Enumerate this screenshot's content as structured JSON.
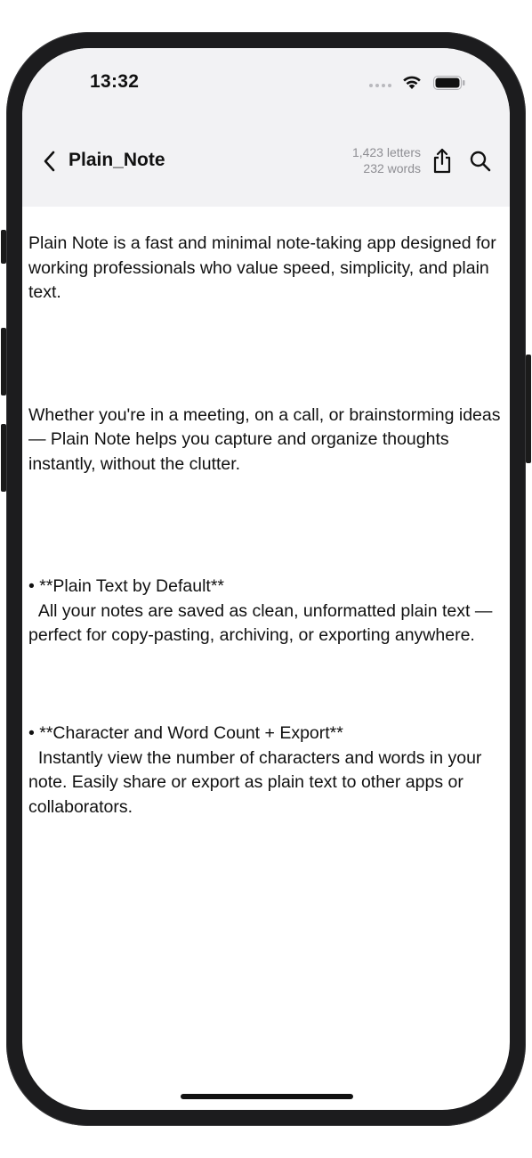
{
  "status_bar": {
    "time": "13:32",
    "icons": [
      "cellular-signal-icon",
      "wifi-icon",
      "battery-icon"
    ]
  },
  "nav": {
    "back_icon": "chevron-left-icon",
    "title": "Plain_Note",
    "letters": "1,423 letters",
    "words": "232 words",
    "share_icon": "share-icon",
    "search_icon": "search-icon"
  },
  "note": {
    "text": "Plain Note is a fast and minimal note-taking app designed for working professionals who value speed, simplicity, and plain text.\n\n\n\n\nWhether you're in a meeting, on a call, or brainstorming ideas — Plain Note helps you capture and organize thoughts instantly, without the clutter.\n\n\n\n\n• **Plain Text by Default**\n  All your notes are saved as clean, unformatted plain text — perfect for copy-pasting, archiving, or exporting anywhere.\n\n\n\n• **Character and Word Count + Export**\n  Instantly view the number of characters and words in your note. Easily share or export as plain text to other apps or collaborators."
  },
  "colors": {
    "header_bg": "#f2f2f4",
    "text": "#111111",
    "secondary_text": "#8e8e93",
    "frame": "#1c1c1e"
  }
}
